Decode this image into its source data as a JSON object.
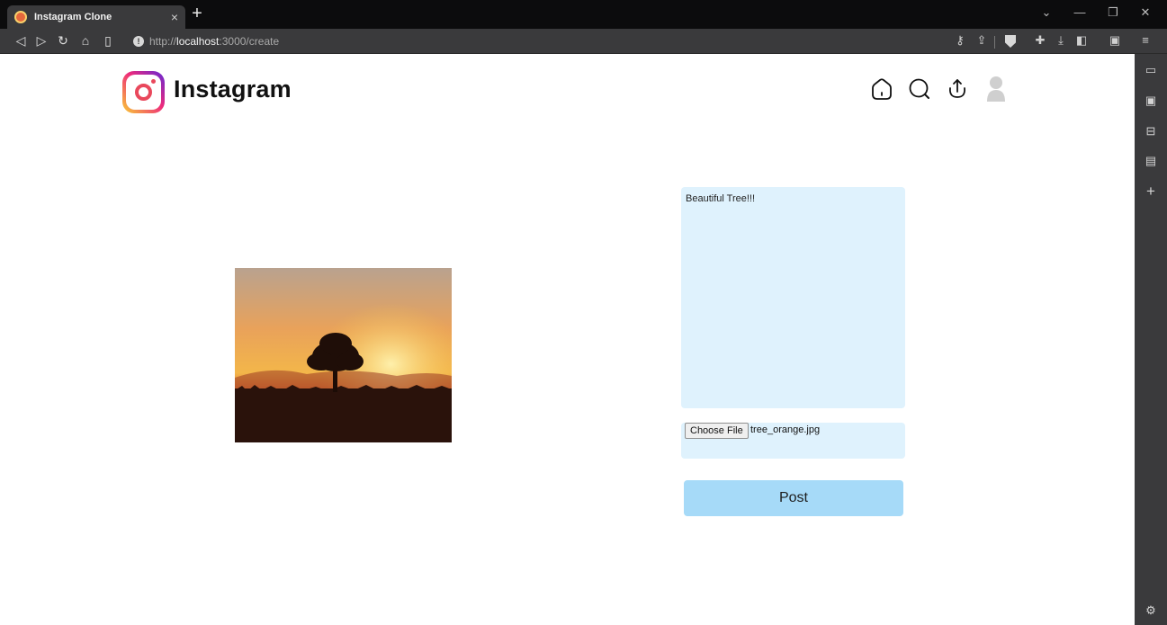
{
  "browser": {
    "tab_title": "Instagram Clone",
    "tab_close": "×",
    "new_tab": "+",
    "url_prefix": "http://",
    "url_host": "localhost",
    "url_path": ":3000/create",
    "icons": [
      "back-icon",
      "forward-icon",
      "reload-icon",
      "home-icon",
      "bookmark-icon",
      "site-info-icon",
      "key-icon",
      "share-icon",
      "brave-shields-icon",
      "extensions-icon",
      "download-icon",
      "sidebar-icon",
      "wallet-icon",
      "menu-icon"
    ],
    "side_icons": [
      "camera-icon",
      "wallet-icon",
      "save-icon",
      "reading-list-icon",
      "add-icon",
      "settings-icon"
    ]
  },
  "header": {
    "brand": "Instagram",
    "nav_icons": [
      "home-icon",
      "search-icon",
      "upload-icon",
      "profile-avatar"
    ]
  },
  "create": {
    "caption": "Beautiful Tree!!!",
    "file_button": "Choose File",
    "file_name": "tree_orange.jpg",
    "post_label": "Post"
  }
}
